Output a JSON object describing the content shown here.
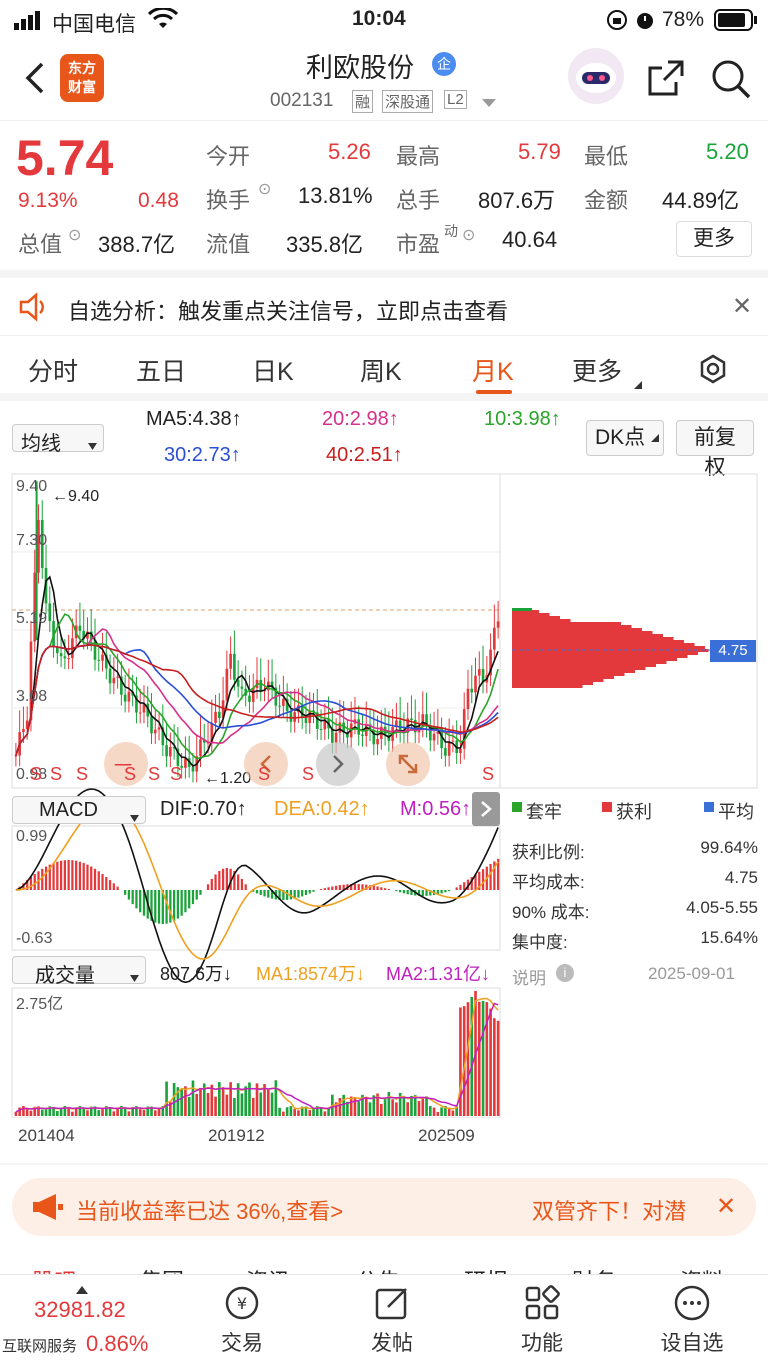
{
  "status": {
    "carrier": "中国电信",
    "time": "10:04",
    "battery": "78%"
  },
  "nav": {
    "title": "利欧股份",
    "badge": "企",
    "logo_line1": "东方",
    "logo_line2": "财富",
    "code": "002131",
    "tag1": "融",
    "tag2": "深股通",
    "tag3": "L2"
  },
  "quote": {
    "price": "5.74",
    "pct": "9.13%",
    "chg": "0.48",
    "open_label": "今开",
    "open": "5.26",
    "high_label": "最高",
    "high": "5.79",
    "low_label": "最低",
    "low": "5.20",
    "turnover_label": "换手",
    "turnover": "13.81%",
    "vol_label": "总手",
    "vol": "807.6万",
    "amount_label": "金额",
    "amount": "44.89亿",
    "mcap_label": "总值",
    "mcap": "388.7亿",
    "float_label": "流值",
    "float": "335.8亿",
    "pe_label": "市盈",
    "pe_sup": "动",
    "pe": "40.64",
    "more": "更多"
  },
  "notice": {
    "text": "自选分析：触发重点关注信号，立即点击查看"
  },
  "tabs": [
    "分时",
    "五日",
    "日K",
    "周K",
    "月K",
    "更多"
  ],
  "tabs_active": 4,
  "ma": {
    "selector": "均线",
    "ma5": "MA5:4.38↑",
    "ma20": "20:2.98↑",
    "ma10": "10:3.98↑",
    "ma30": "30:2.73↑",
    "ma40": "40:2.51↑",
    "dk": "DK点",
    "fq": "前复权"
  },
  "chart": {
    "y1": "9.40",
    "y2": "7.30",
    "y3": "5.19",
    "y4": "3.08",
    "y5": "0.98",
    "max_mark": "←9.40",
    "min_mark": "←1.20",
    "s_mark": "S",
    "one_mark": "一",
    "avg_cost_tag": "4.75",
    "macd_sel": "MACD",
    "dif": "DIF:0.70↑",
    "dea": "DEA:0.42↑",
    "m": "M:0.56↑",
    "macd_hi": "0.99",
    "macd_lo": "-0.63",
    "vol_sel": "成交量",
    "vol_now": "807.6万↓",
    "vma1": "MA1:8574万↓",
    "vma2": "MA2:1.31亿↓",
    "vol_hi": "2.75亿",
    "x1": "201404",
    "x2": "201912",
    "x3": "202509"
  },
  "chip": {
    "leg1": "套牢",
    "leg2": "获利",
    "leg3": "平均",
    "rows": [
      {
        "k": "获利比例:",
        "v": "99.64%"
      },
      {
        "k": "平均成本:",
        "v": "4.75"
      },
      {
        "k": "90% 成本:",
        "v": "4.05-5.55"
      },
      {
        "k": "集中度:",
        "v": "15.64%"
      }
    ],
    "note_label": "说明",
    "date": "2025-09-01"
  },
  "ad": {
    "text1": "当前收益率已达 36%,查看>",
    "text2": "双管齐下！对潜"
  },
  "bottom_tabs": [
    "股吧",
    "集团",
    "资讯",
    "公告",
    "研报",
    "财务",
    "资料"
  ],
  "toolbar": {
    "index": "32981.82",
    "index_label": "互联网服务",
    "index_pct": "0.86%",
    "trade": "交易",
    "post": "发帖",
    "func": "功能",
    "watch": "设自选"
  },
  "colors": {
    "up": "#e4393c",
    "down": "#1aa33a",
    "accent": "#e8561a"
  }
}
